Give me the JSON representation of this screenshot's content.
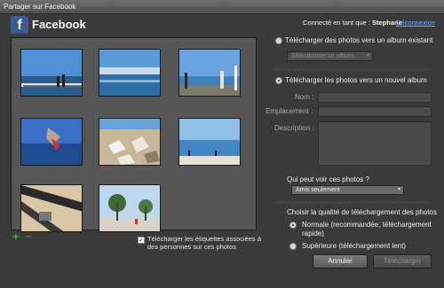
{
  "window": {
    "title": "Partager sur Facebook"
  },
  "header": {
    "logo_letter": "f",
    "brand": "Facebook",
    "connected_label": "Connecté en tant que :",
    "user": "Stephane",
    "logout": "Déconnexion"
  },
  "gallery": {
    "add_symbol": "+",
    "remove_symbol": "−",
    "tag_checked": true,
    "tag_check_mark": "✓",
    "tag_label": "Télécharger les étiquettes associées à des personnes sur ces photos"
  },
  "upload": {
    "existing_label": "Télécharger des photos vers un album existant",
    "existing_select": "Sélectionner un album...",
    "new_label": "Télécharger les photos vers un nouvel album",
    "name_label": "Nom :",
    "location_label": "Emplacement :",
    "description_label": "Description :"
  },
  "privacy": {
    "question": "Qui peut voir ces photos ?",
    "selected": "Amis seulement"
  },
  "quality": {
    "title": "Choisir la qualité de téléchargement des photos",
    "normal_label": "Normale (recommandée, téléchargement rapide)",
    "high_label": "Supérieure (téléchargement lent)"
  },
  "actions": {
    "cancel": "Annuler",
    "upload": "Télécharger"
  },
  "icons": {
    "arrow": "▾"
  }
}
